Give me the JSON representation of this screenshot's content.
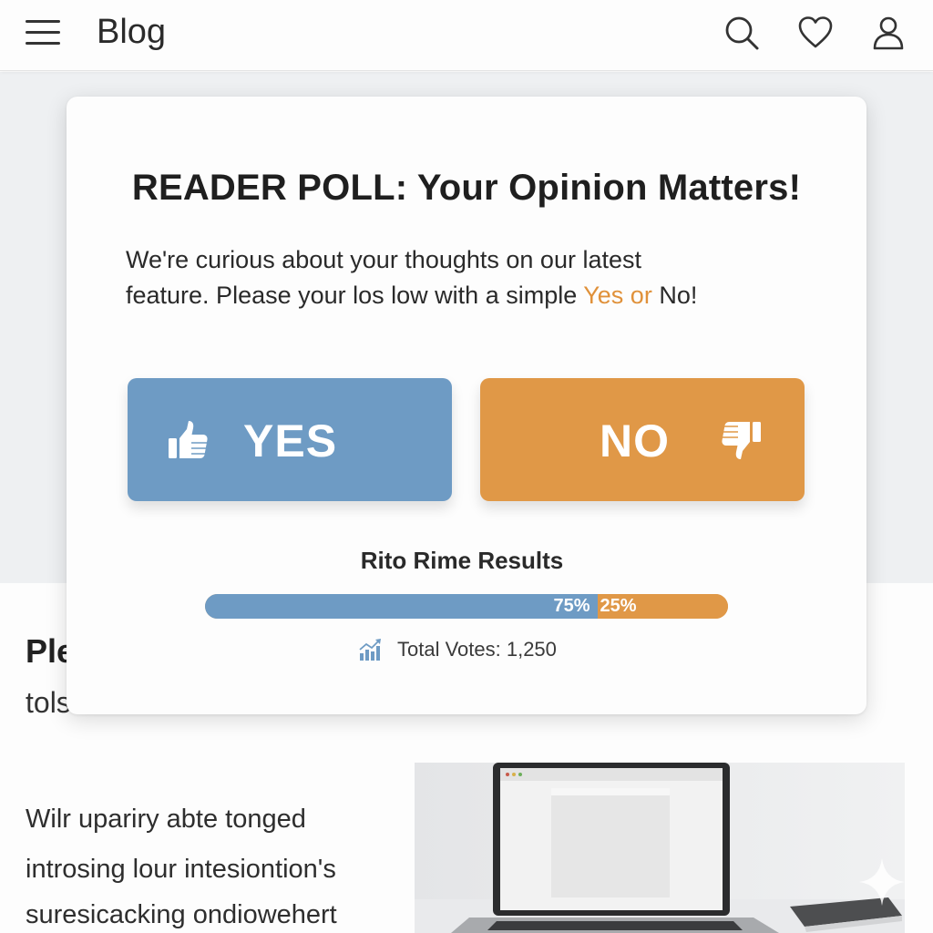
{
  "header": {
    "brand": "Blog",
    "icons": [
      "menu-icon",
      "search-icon",
      "heart-icon",
      "user-icon"
    ]
  },
  "poll": {
    "title": "READER POLL: Your Opinion Matters!",
    "description_line1": "We're curious about your thoughts on our latest",
    "description_line2_prefix": "feature. Please your los low with a simple ",
    "description_yes": "Yes",
    "description_or": " or",
    "description_no": " No!",
    "yes_label": "YES",
    "no_label": "NO",
    "yes_icon": "thumbs-up-icon",
    "no_icon": "thumbs-down-icon",
    "results_title": "Rito Rime Results",
    "yes_percent": 75,
    "no_percent": 25,
    "yes_percent_label": "75%",
    "no_percent_label": "25%",
    "total_votes": "Total Votes: 1,250",
    "stats_icon": "chart-icon"
  },
  "article": {
    "title_partial": "Ple",
    "subtitle_partial": "tols",
    "paragraph_lines": [
      "Wilr upariry abte tonged",
      "introsing lour intesiontion's",
      "suresicacking ondiowehert"
    ],
    "image": "laptop-photo"
  },
  "colors": {
    "yes": "#6e9bc4",
    "no": "#e09847",
    "highlight": "#e0913a"
  }
}
